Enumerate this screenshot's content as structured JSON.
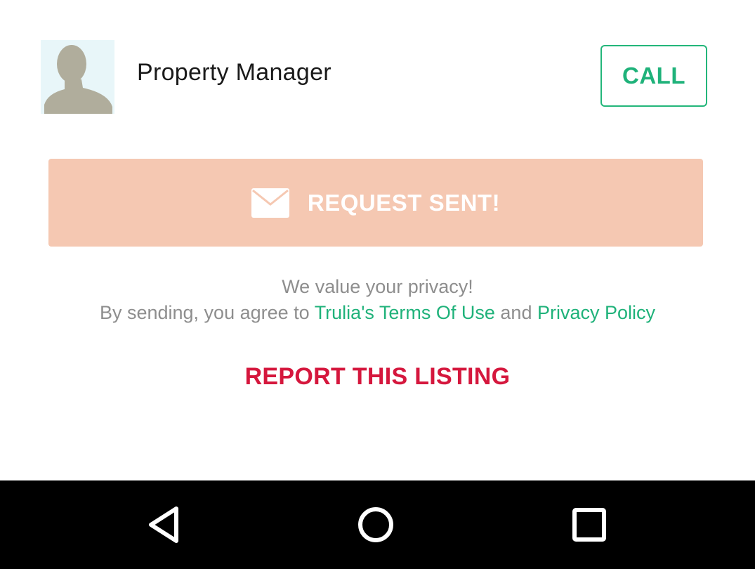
{
  "contact": {
    "name": "Property Manager",
    "avatar_icon": "person-silhouette-icon",
    "call_label": "CALL"
  },
  "request": {
    "icon": "envelope-icon",
    "label": "REQUEST SENT!"
  },
  "privacy": {
    "line1": "We value your privacy!",
    "prefix": "By sending, you agree to",
    "terms_link": "Trulia's Terms Of Use",
    "conjunction": "and",
    "policy_link": "Privacy Policy"
  },
  "report_label": "REPORT THIS LISTING",
  "navigation": {
    "back_icon": "back-triangle-icon",
    "home_icon": "home-circle-icon",
    "recents_icon": "recents-square-icon"
  },
  "colors": {
    "accent_green": "#1fb27a",
    "request_bg": "#f5c8b2",
    "report_red": "#d5173d",
    "nav_bg": "#000000"
  }
}
